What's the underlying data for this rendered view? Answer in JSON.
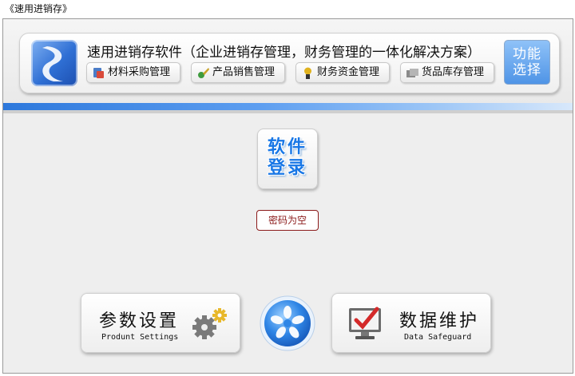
{
  "window": {
    "title": "《速用进销存》"
  },
  "banner": {
    "title": "速用进销存软件（企业进销存管理，财务管理的一体化解决方案）",
    "nav": [
      {
        "label": "材料采购管理",
        "icon": "purchase-icon"
      },
      {
        "label": "产品销售管理",
        "icon": "sales-icon"
      },
      {
        "label": "财务资金管理",
        "icon": "finance-icon"
      },
      {
        "label": "货品库存管理",
        "icon": "inventory-icon"
      }
    ],
    "function_button": {
      "line1": "功能",
      "line2": "选择"
    }
  },
  "login": {
    "line1": "软件",
    "line2": "登录"
  },
  "status": {
    "text": "密码为空"
  },
  "buttons": {
    "params": {
      "title": "参数设置",
      "subtitle": "Produnt Settings",
      "icon": "gears-icon"
    },
    "maintenance": {
      "title": "数据维护",
      "subtitle": "Data Safeguard",
      "icon": "monitor-check-icon"
    },
    "center": {
      "icon": "flower-orb-icon"
    }
  },
  "colors": {
    "accent_blue": "#1877e6",
    "divider_blue": "#2d78dc",
    "status_red": "#8b1a1a",
    "function_button_blue": "#4f94e6"
  }
}
